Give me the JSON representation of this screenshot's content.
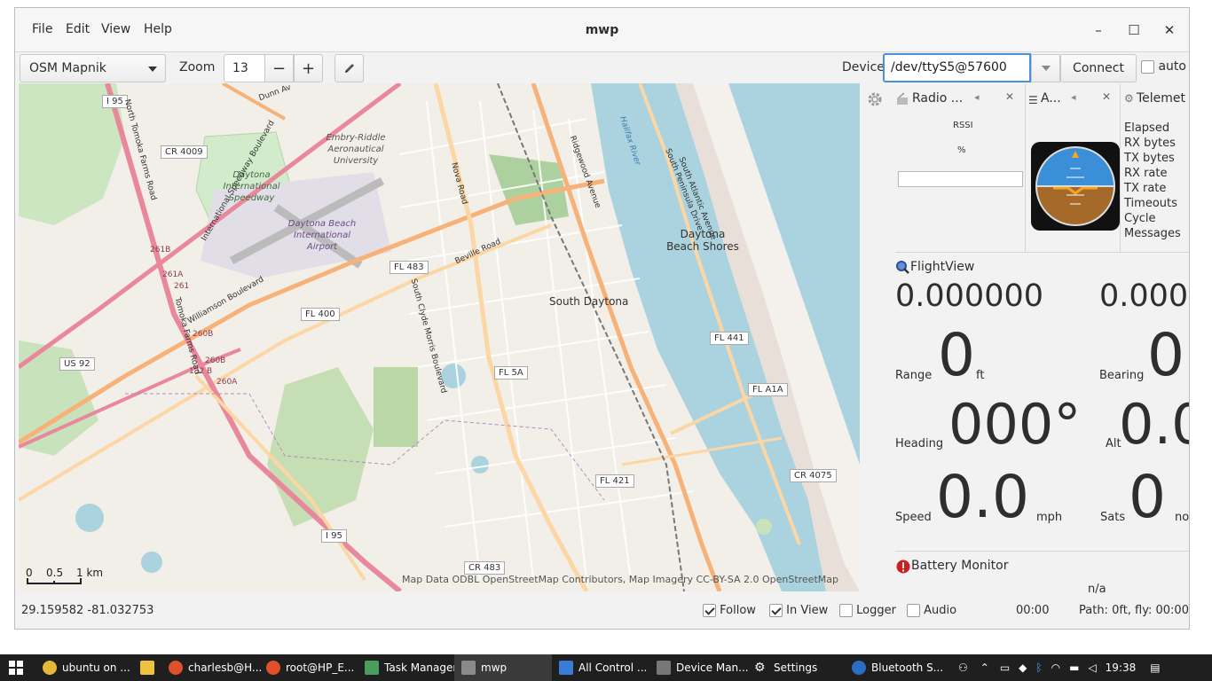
{
  "window": {
    "title": "mwp",
    "menus": [
      "File",
      "Edit",
      "View",
      "Help"
    ],
    "controls": {
      "minimize": "–",
      "maximize": "☐",
      "close": "✕"
    }
  },
  "toolbar": {
    "map_source": "OSM Mapnik",
    "zoom_label": "Zoom",
    "zoom_value": "13",
    "zoom_minus": "−",
    "zoom_plus": "+",
    "device_label": "Device",
    "device_value": "/dev/ttyS5@57600",
    "connect_label": "Connect",
    "auto_label": "auto",
    "auto_checked": false
  },
  "map": {
    "places": [
      "Daytona Beach Shores",
      "South Daytona",
      "Embry-Riddle Aeronautical University",
      "Daytona International Speedway",
      "Daytona Beach International Airport"
    ],
    "roads": [
      "I 95",
      "CR 4009",
      "FL 483",
      "FL 400",
      "US 92",
      "FL 5A",
      "FL 441",
      "FL A1A",
      "FL 421",
      "CR 4075",
      "I 95",
      "CR 483"
    ],
    "street_names": [
      "Ridgewood Avenue",
      "Nova Road",
      "Beville Road",
      "Williamson Boulevard",
      "South Atlantic Avenue",
      "South Peninsula Drive",
      "Halifax River",
      "Dunn Av",
      "Tomoka Farms Road",
      "North Tomoka Farms Road",
      "International Speedway Boulevard",
      "South Clyde Morris Boulevard"
    ],
    "exits": [
      "261B",
      "261A",
      "261",
      "260B",
      "260B",
      "260A",
      "132 B"
    ],
    "attribution": "Map Data ODBL OpenStreetMap Contributors, Map Imagery CC-BY-SA 2.0 OpenStreetMap",
    "scale": {
      "zero": "0",
      "half": "0.5",
      "one": "1 km"
    }
  },
  "panels": {
    "radio": {
      "title": "Radio ...",
      "rssi": "RSSI",
      "percent": "%"
    },
    "ahi": {
      "title": "A..."
    },
    "telemetry": {
      "title": "Telemet",
      "items": [
        "Elapsed",
        "RX bytes",
        "TX bytes",
        "RX rate",
        "TX rate",
        "Timeouts",
        "Cycle",
        "Messages"
      ]
    },
    "flightview": {
      "title": "FlightView",
      "lat": "0.000000",
      "lon": "0.000",
      "range_label": "Range",
      "range_value": "0",
      "range_unit": "ft",
      "bearing_label": "Bearing",
      "bearing_value": "0",
      "heading_label": "Heading",
      "heading_value": "000°",
      "alt_label": "Alt",
      "alt_value": "0.0",
      "speed_label": "Speed",
      "speed_value": "0.0",
      "speed_unit": "mph",
      "sats_label": "Sats",
      "sats_value": "0",
      "sats_unit": "no"
    },
    "battery": {
      "title": "Battery Monitor",
      "value": "n/a"
    }
  },
  "status": {
    "coords": "29.159582 -81.032753",
    "follow_label": "Follow",
    "follow_checked": true,
    "inview_label": "In View",
    "inview_checked": true,
    "logger_label": "Logger",
    "logger_checked": false,
    "audio_label": "Audio",
    "audio_checked": false,
    "time": "00:00",
    "path": "Path: 0ft, fly: 00:00"
  },
  "taskbar": {
    "items": [
      "ubuntu on ...",
      "charlesb@H...",
      "root@HP_E...",
      "Task Manager",
      "mwp",
      "All Control ...",
      "Device Man...",
      "Settings",
      "Bluetooth S..."
    ],
    "clock": "19:38"
  }
}
